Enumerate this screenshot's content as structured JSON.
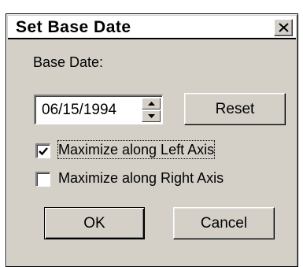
{
  "dialog": {
    "title": "Set Base Date",
    "close_glyph": "✕"
  },
  "base_date": {
    "label": "Base Date:",
    "value": "06/15/1994"
  },
  "buttons": {
    "reset": "Reset",
    "ok": "OK",
    "cancel": "Cancel"
  },
  "checkboxes": [
    {
      "label": "Maximize along Left Axis",
      "checked": true
    },
    {
      "label": "Maximize along Right Axis",
      "checked": false
    }
  ],
  "icons": {
    "close": "close-icon",
    "spin_up": "spin-up-arrow-icon",
    "spin_down": "spin-down-arrow-icon",
    "check": "checkmark-icon"
  },
  "colors": {
    "dialog_face": "#d4d0c8",
    "titlebar": "#ffffff",
    "text": "#000000"
  }
}
